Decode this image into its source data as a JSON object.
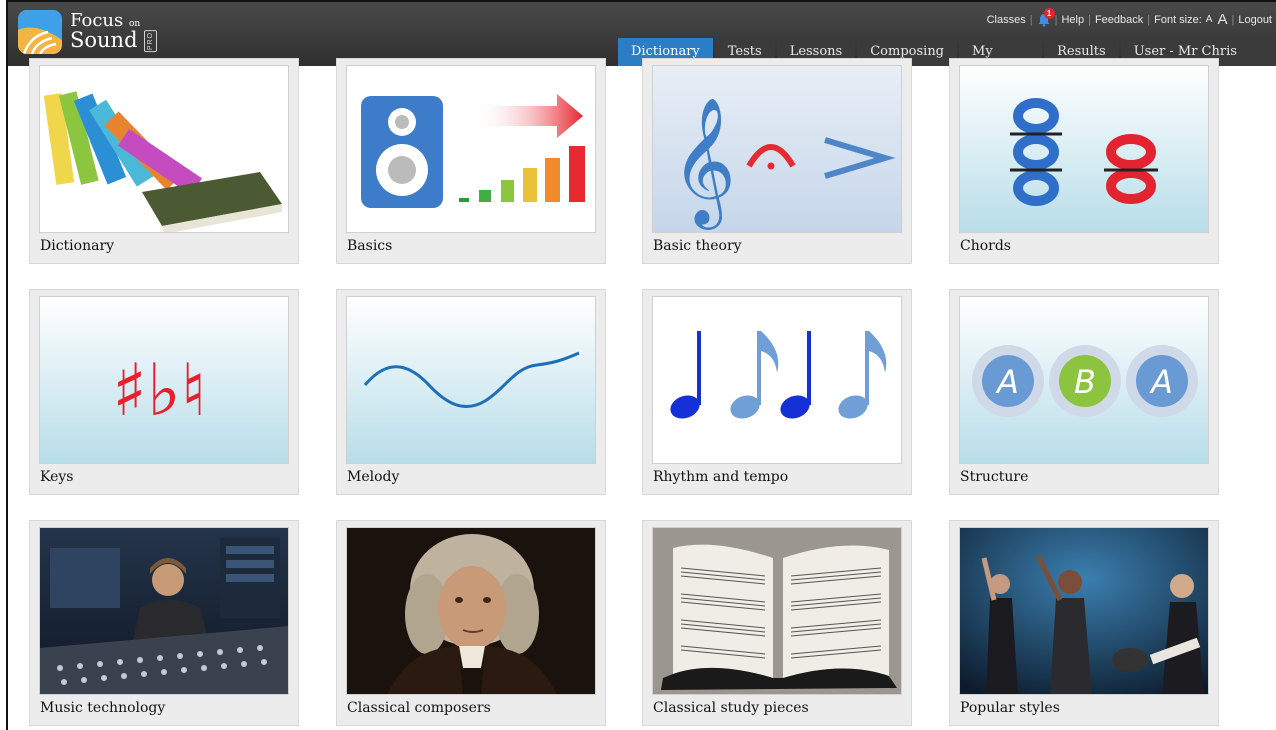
{
  "app": {
    "logo_line1": "Focus",
    "logo_on": "on",
    "logo_line2": "Sound",
    "logo_badge": "PRO"
  },
  "utility_bar": {
    "classes": "Classes",
    "notification_count": "1",
    "help": "Help",
    "feedback": "Feedback",
    "font_size": "Font size:",
    "font_small": "A",
    "font_large": "A",
    "logout": "Logout"
  },
  "nav": {
    "tabs": [
      {
        "label": "Dictionary",
        "active": true
      },
      {
        "label": "Tests"
      },
      {
        "label": "Lessons"
      },
      {
        "label": "Composing"
      },
      {
        "label": "My School"
      },
      {
        "label": "Results"
      },
      {
        "label": "User - Mr Chris Salmon"
      }
    ]
  },
  "categories": [
    {
      "label": "Dictionary",
      "icon": "books-icon"
    },
    {
      "label": "Basics",
      "icon": "speaker-volume-icon"
    },
    {
      "label": "Basic theory",
      "icon": "treble-clef-icon"
    },
    {
      "label": "Chords",
      "icon": "chord-notes-icon"
    },
    {
      "label": "Keys",
      "icon": "accidentals-icon"
    },
    {
      "label": "Melody",
      "icon": "melody-wave-icon"
    },
    {
      "label": "Rhythm and tempo",
      "icon": "notes-icon"
    },
    {
      "label": "Structure",
      "icon": "aba-form-icon"
    },
    {
      "label": "Music technology",
      "icon": "mixing-desk-photo"
    },
    {
      "label": "Classical composers",
      "icon": "composer-portrait-photo"
    },
    {
      "label": "Classical study pieces",
      "icon": "sheet-music-photo"
    },
    {
      "label": "Popular styles",
      "icon": "rock-band-photo"
    }
  ],
  "colors": {
    "header_bg": "#3a3a3a",
    "active_tab": "#2b7dc6",
    "accent_blue": "#2f6ec9",
    "accent_red": "#e32430",
    "accent_green": "#8cc43f"
  }
}
